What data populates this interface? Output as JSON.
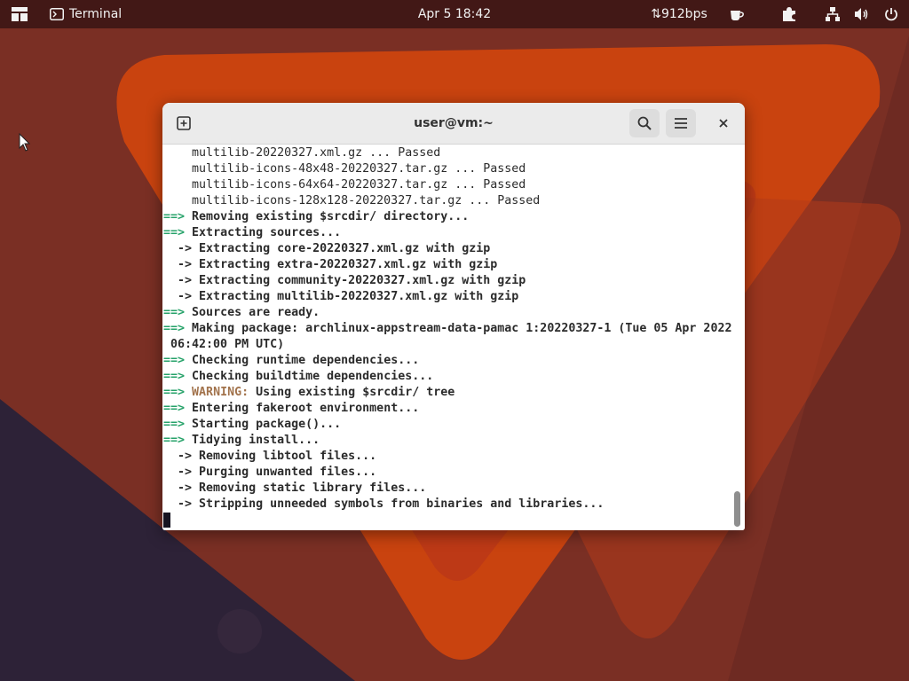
{
  "topbar": {
    "activities_icon": "activities-grid-icon",
    "app_name": "Terminal",
    "app_icon": "terminal-app-icon",
    "clock": "Apr 5  18:42",
    "net_speed": "⇅912bps",
    "indicators": [
      "coffee-cup-icon",
      "puzzle-extension-icon",
      "network-wired-icon",
      "volume-icon",
      "power-icon"
    ]
  },
  "window": {
    "title": "user@vm:~",
    "buttons": {
      "new_tab": "new-tab-icon",
      "search": "search-icon",
      "menu": "hamburger-menu-icon",
      "close": "close-icon"
    }
  },
  "terminal": {
    "lines": [
      {
        "indent": "    ",
        "text": "multilib-20220327.xml.gz ... Passed"
      },
      {
        "indent": "    ",
        "text": "multilib-icons-48x48-20220327.tar.gz ... Passed"
      },
      {
        "indent": "    ",
        "text": "multilib-icons-64x64-20220327.tar.gz ... Passed"
      },
      {
        "indent": "    ",
        "text": "multilib-icons-128x128-20220327.tar.gz ... Passed"
      },
      {
        "prefix": "==>",
        "text": "Removing existing $srcdir/ directory..."
      },
      {
        "prefix": "==>",
        "text": "Extracting sources..."
      },
      {
        "sub": "  ->",
        "text": "Extracting core-20220327.xml.gz with gzip"
      },
      {
        "sub": "  ->",
        "text": "Extracting extra-20220327.xml.gz with gzip"
      },
      {
        "sub": "  ->",
        "text": "Extracting community-20220327.xml.gz with gzip"
      },
      {
        "sub": "  ->",
        "text": "Extracting multilib-20220327.xml.gz with gzip"
      },
      {
        "prefix": "==>",
        "text": "Sources are ready."
      },
      {
        "prefix": "==>",
        "text": "Making package: archlinux-appstream-data-pamac 1:20220327-1 (Tue 05 Apr 2022"
      },
      {
        "indent": " ",
        "text": "06:42:00 PM UTC)"
      },
      {
        "prefix": "==>",
        "text": "Checking runtime dependencies..."
      },
      {
        "prefix": "==>",
        "text": "Checking buildtime dependencies..."
      },
      {
        "prefix": "==>",
        "warning": "WARNING:",
        "text": "Using existing $srcdir/ tree"
      },
      {
        "prefix": "==>",
        "text": "Entering fakeroot environment..."
      },
      {
        "prefix": "==>",
        "text": "Starting package()..."
      },
      {
        "prefix": "==>",
        "text": "Tidying install..."
      },
      {
        "sub": "  ->",
        "text": "Removing libtool files..."
      },
      {
        "sub": "  ->",
        "text": "Purging unwanted files..."
      },
      {
        "sub": "  ->",
        "text": "Removing static library files..."
      },
      {
        "sub": "  ->",
        "text": "Stripping unneeded symbols from binaries and libraries..."
      }
    ]
  },
  "colors": {
    "arrow_green": "#26a269",
    "warning_brown": "#a2734c",
    "headerbar": "#ebebeb",
    "wallpaper_orange": "#c2410c",
    "wallpaper_dark": "#2b1f33"
  }
}
